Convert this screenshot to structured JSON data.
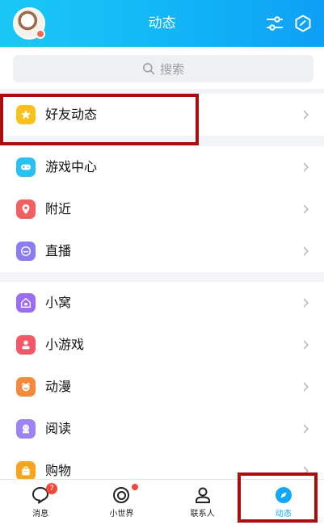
{
  "header": {
    "title": "动态",
    "left_avatar_icon": "user-avatar",
    "right_icons": [
      "settings-sliders-icon",
      "hexagon-check-icon"
    ],
    "bg_color": "#12b5f7"
  },
  "search": {
    "placeholder": "搜索"
  },
  "groups": [
    {
      "items": [
        {
          "label": "好友动态",
          "icon": "star-icon",
          "color": "#f8c21b"
        }
      ]
    },
    {
      "items": [
        {
          "label": "游戏中心",
          "icon": "gamepad-icon",
          "color": "#27c2f3"
        },
        {
          "label": "附近",
          "icon": "location-pin-icon",
          "color": "#f45f5f"
        },
        {
          "label": "直播",
          "icon": "live-icon",
          "color": "#8a7df2"
        }
      ]
    },
    {
      "items": [
        {
          "label": "小窝",
          "icon": "home-icon",
          "color": "#9b6df3"
        },
        {
          "label": "小游戏",
          "icon": "person-game-icon",
          "color": "#f2586a"
        },
        {
          "label": "动漫",
          "icon": "anime-face-icon",
          "color": "#f58a3c"
        },
        {
          "label": "阅读",
          "icon": "reading-icon",
          "color": "#9d84f2"
        },
        {
          "label": "购物",
          "icon": "shopping-bag-icon",
          "color": "#f7a41e"
        }
      ]
    }
  ],
  "tabs": [
    {
      "label": "消息",
      "icon": "message-icon",
      "badge": "7"
    },
    {
      "label": "小世界",
      "icon": "world-icon",
      "dot": true
    },
    {
      "label": "联系人",
      "icon": "contacts-icon"
    },
    {
      "label": "动态",
      "icon": "dynamic-icon",
      "active": true
    }
  ],
  "highlight_color": "#a80d10"
}
